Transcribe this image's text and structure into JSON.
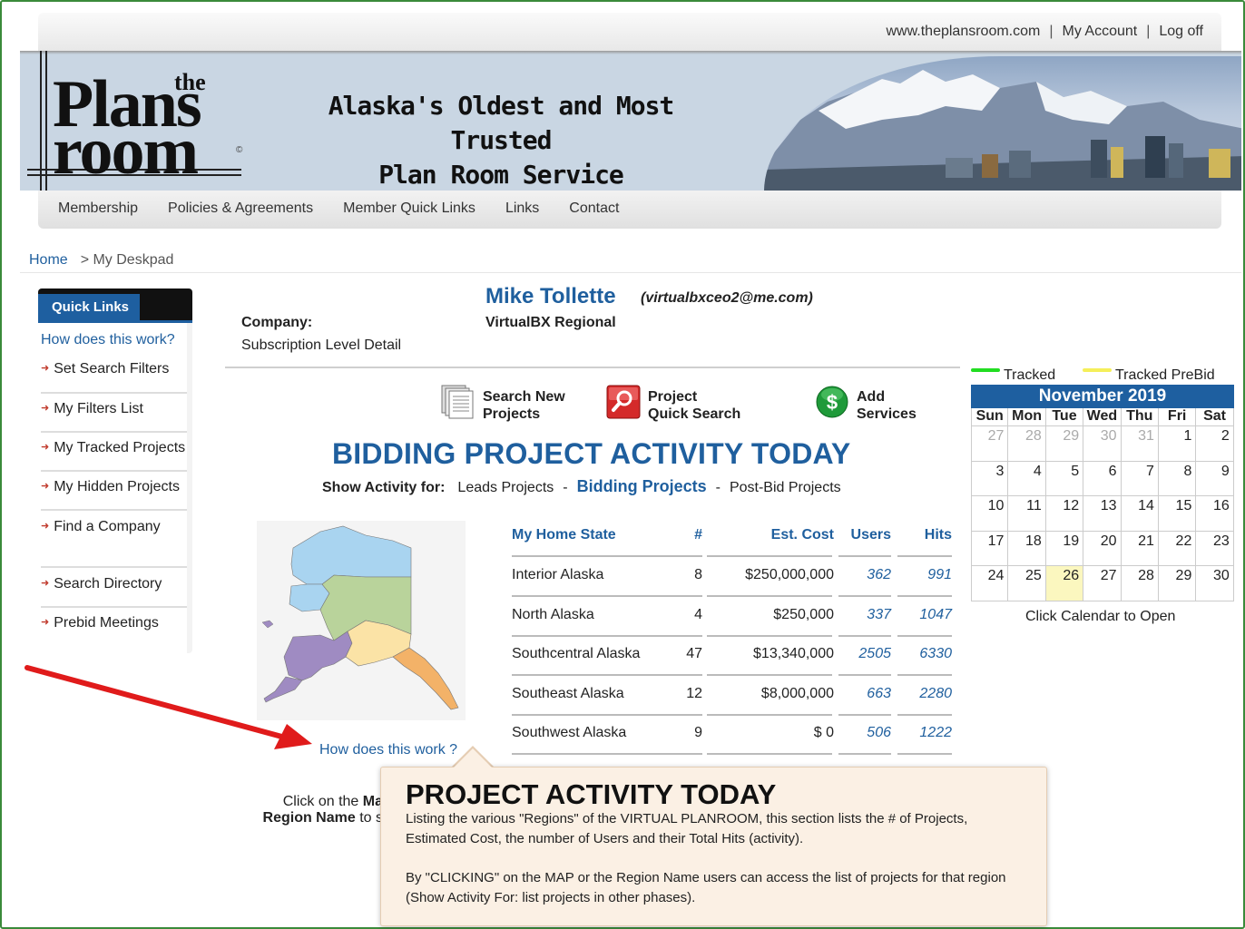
{
  "header": {
    "links": [
      "www.theplansroom.com",
      "My Account",
      "Log off"
    ],
    "separator": "|"
  },
  "banner": {
    "logo_the": "the",
    "logo_plans": "Plans",
    "logo_room": "room",
    "logo_copyright": "©",
    "tagline_line1": "Alaska's Oldest and Most Trusted",
    "tagline_line2": "Plan Room Service"
  },
  "nav": {
    "items": [
      "Membership",
      "Policies & Agreements",
      "Member Quick Links",
      "Links",
      "Contact"
    ]
  },
  "breadcrumb": {
    "home": "Home",
    "current": "> My Deskpad"
  },
  "quick_links": {
    "title": "Quick Links",
    "how": "How does this work?",
    "items": [
      "Set Search Filters",
      "My Filters List",
      "My Tracked Projects",
      "My Hidden Projects",
      "Find a Company",
      "Search Directory",
      "Prebid Meetings"
    ]
  },
  "member": {
    "name": "Mike Tollette",
    "email": "(virtualbxceo2@me.com)",
    "company_label": "Company:",
    "company": "VirtualBX Regional",
    "subscription": "Subscription Level Detail"
  },
  "actions": {
    "search_new_1": "Search New",
    "search_new_2": "Projects",
    "quick_search_1": "Project",
    "quick_search_2": "Quick Search",
    "add_services_1": "Add",
    "add_services_2": "Services"
  },
  "activity": {
    "title": "BIDDING PROJECT ACTIVITY TODAY",
    "show_label": "Show Activity for:",
    "opt_leads": "Leads Projects",
    "opt_bidding": "Bidding Projects",
    "opt_postbid": "Post-Bid Projects",
    "dash": "-"
  },
  "map": {
    "how": "How does this work ?",
    "click_1": "Click on the",
    "click_1b": "Ma",
    "click_2": "Region Name",
    "click_2b": " to s",
    "region_colors": {
      "north": "#a9d4f0",
      "interior": "#b9d39b",
      "southwest": "#9f8bc2",
      "southcentral": "#fbe3a6",
      "southeast": "#f3b268"
    }
  },
  "table": {
    "headers": [
      "My Home State",
      "#",
      "Est. Cost",
      "Users",
      "Hits"
    ],
    "rows": [
      [
        "Interior Alaska",
        "8",
        "$250,000,000",
        "362",
        "991"
      ],
      [
        "North Alaska",
        "4",
        "$250,000",
        "337",
        "1047"
      ],
      [
        "Southcentral Alaska",
        "47",
        "$13,340,000",
        "2505",
        "6330"
      ],
      [
        "Southeast Alaska",
        "12",
        "$8,000,000",
        "663",
        "2280"
      ],
      [
        "Southwest Alaska",
        "9",
        "$ 0",
        "506",
        "1222"
      ]
    ]
  },
  "calendar": {
    "legend_tracked": "Tracked",
    "legend_prebid": "Tracked PreBid",
    "legend_tracked_color": "#22dd22",
    "legend_prebid_color": "#f5ef5a",
    "month": "November 2019",
    "dow": [
      "Sun",
      "Mon",
      "Tue",
      "Wed",
      "Thu",
      "Fri",
      "Sat"
    ],
    "days": [
      "27",
      "28",
      "29",
      "30",
      "31",
      "1",
      "2",
      "3",
      "4",
      "5",
      "6",
      "7",
      "8",
      "9",
      "10",
      "11",
      "12",
      "13",
      "14",
      "15",
      "16",
      "17",
      "18",
      "19",
      "20",
      "21",
      "22",
      "23",
      "24",
      "25",
      "26",
      "27",
      "28",
      "29",
      "30"
    ],
    "other_month_count": 5,
    "today": "26",
    "footer": "Click Calendar to Open"
  },
  "tooltip": {
    "title": "PROJECT ACTIVITY TODAY",
    "p1": "Listing the various \"Regions\" of the VIRTUAL PLANROOM, this section lists the # of Projects, Estimated Cost, the number of Users and their Total Hits (activity).",
    "p2": "By \"CLICKING\" on the MAP or the Region Name users can access the list of projects for that region (Show Activity For: list projects in other phases)."
  },
  "colors": {
    "brand_blue": "#1f5f9e",
    "annotation_arrow": "#e01b1b"
  }
}
